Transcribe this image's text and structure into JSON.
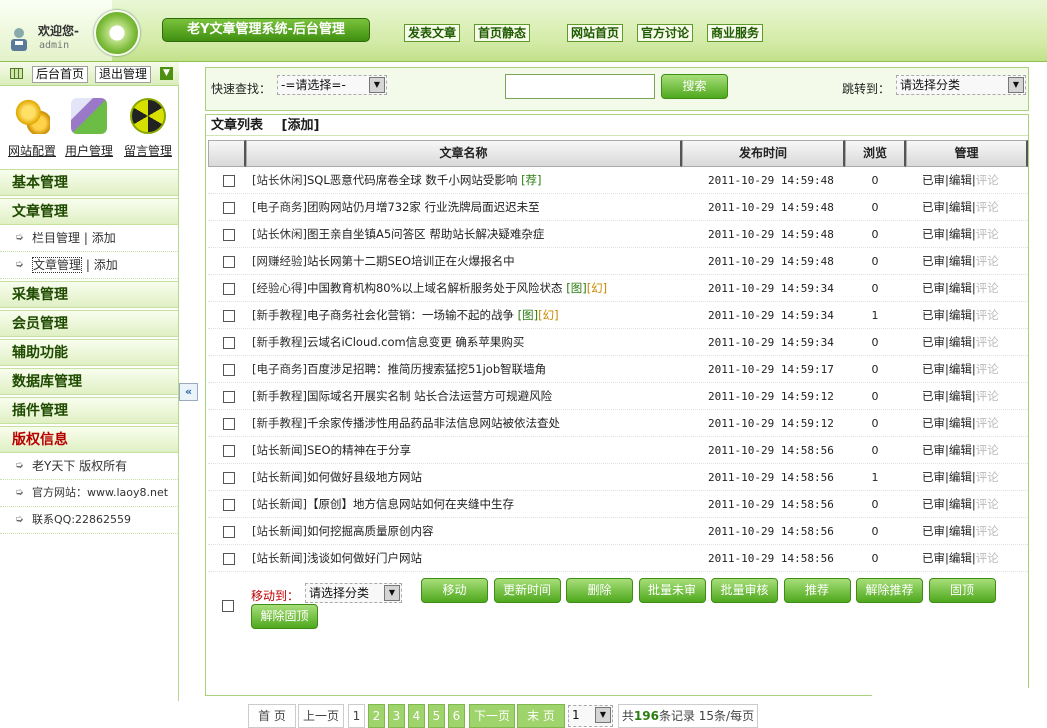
{
  "header": {
    "welcome": "欢迎您-",
    "username": "admin",
    "system_title": "老Y文章管理系统-后台管理",
    "nav": [
      "发表文章",
      "首页静态",
      "网站首页",
      "官方讨论",
      "商业服务"
    ]
  },
  "sidebar": {
    "home_btn": "后台首页",
    "logout_btn": "退出管理",
    "quick": [
      {
        "label": "网站配置",
        "icon": "gears-icon"
      },
      {
        "label": "用户管理",
        "icon": "user-edit-icon"
      },
      {
        "label": "留言管理",
        "icon": "radiation-icon"
      }
    ],
    "sections": [
      {
        "label": "基本管理"
      },
      {
        "label": "文章管理"
      },
      {
        "label": "采集管理"
      },
      {
        "label": "会员管理"
      },
      {
        "label": "辅助功能"
      },
      {
        "label": "数据库管理"
      },
      {
        "label": "插件管理"
      },
      {
        "label": "版权信息"
      }
    ],
    "article_items": [
      {
        "label": "栏目管理",
        "sep": " | ",
        "add": "添加"
      },
      {
        "label": "文章管理",
        "sep": " | ",
        "add": "添加"
      }
    ],
    "copyright_items": [
      "老Y天下 版权所有",
      "官方网站：www.laoy8.net",
      "联系QQ:22862559"
    ]
  },
  "search": {
    "label": "快速查找：",
    "select": "-=请选择=-",
    "button": "搜索",
    "jump_label": "跳转到：",
    "jump_select": "请选择分类"
  },
  "list": {
    "title": "文章列表",
    "add": "[添加]",
    "columns": [
      "文章名称",
      "发布时间",
      "浏览",
      "管理"
    ],
    "rows": [
      {
        "cat": "[站长休闲]",
        "title": "SQL恶意代码席卷全球 数千小网站受影响",
        "tag": "[荐]",
        "tag2": "",
        "time": "2011-10-29 14:59:48",
        "views": "0"
      },
      {
        "cat": "[电子商务]",
        "title": "团购网站仍月增732家 行业洗牌局面迟迟未至",
        "tag": "",
        "tag2": "",
        "time": "2011-10-29 14:59:48",
        "views": "0"
      },
      {
        "cat": "[站长休闲]",
        "title": "图王亲自坐镇A5问答区 帮助站长解决疑难杂症",
        "tag": "",
        "tag2": "",
        "time": "2011-10-29 14:59:48",
        "views": "0"
      },
      {
        "cat": "[网赚经验]",
        "title": "站长网第十二期SEO培训正在火爆报名中",
        "tag": "",
        "tag2": "",
        "time": "2011-10-29 14:59:48",
        "views": "0"
      },
      {
        "cat": "[经验心得]",
        "title": "中国教育机构80%以上域名解析服务处于风险状态",
        "tag": "[图]",
        "tag2": "[幻]",
        "time": "2011-10-29 14:59:34",
        "views": "0"
      },
      {
        "cat": "[新手教程]",
        "title": "电子商务社会化营销：一场输不起的战争",
        "tag": "[图]",
        "tag2": "[幻]",
        "time": "2011-10-29 14:59:34",
        "views": "1"
      },
      {
        "cat": "[新手教程]",
        "title": "云域名iCloud.com信息变更 确系苹果购买",
        "tag": "",
        "tag2": "",
        "time": "2011-10-29 14:59:34",
        "views": "0"
      },
      {
        "cat": "[电子商务]",
        "title": "百度涉足招聘：推简历搜索猛挖51job智联墙角",
        "tag": "",
        "tag2": "",
        "time": "2011-10-29 14:59:17",
        "views": "0"
      },
      {
        "cat": "[新手教程]",
        "title": "国际域名开展实名制 站长合法运营方可规避风险",
        "tag": "",
        "tag2": "",
        "time": "2011-10-29 14:59:12",
        "views": "0"
      },
      {
        "cat": "[新手教程]",
        "title": "千余家传播涉性用品药品非法信息网站被依法查处",
        "tag": "",
        "tag2": "",
        "time": "2011-10-29 14:59:12",
        "views": "0"
      },
      {
        "cat": "[站长新闻]",
        "title": "SEO的精神在于分享",
        "tag": "",
        "tag2": "",
        "time": "2011-10-29 14:58:56",
        "views": "0"
      },
      {
        "cat": "[站长新闻]",
        "title": "如何做好县级地方网站",
        "tag": "",
        "tag2": "",
        "time": "2011-10-29 14:58:56",
        "views": "1"
      },
      {
        "cat": "[站长新闻]",
        "title": "【原创】地方信息网站如何在夹缝中生存",
        "tag": "",
        "tag2": "",
        "time": "2011-10-29 14:58:56",
        "views": "0"
      },
      {
        "cat": "[站长新闻]",
        "title": "如何挖掘高质量原创内容",
        "tag": "",
        "tag2": "",
        "time": "2011-10-29 14:58:56",
        "views": "0"
      },
      {
        "cat": "[站长新闻]",
        "title": "浅谈如何做好门户网站",
        "tag": "",
        "tag2": "",
        "time": "2011-10-29 14:58:56",
        "views": "0"
      }
    ],
    "manage": {
      "approved": "已审",
      "edit": "编辑",
      "comment": "评论",
      "sep": "|"
    }
  },
  "batch": {
    "move_label": "移动到：",
    "select": "请选择分类",
    "buttons": [
      "移动",
      "更新时间",
      "删除",
      "批量未审",
      "批量审核",
      "推荐",
      "解除推荐",
      "固顶",
      "解除固顶"
    ]
  },
  "pager": {
    "first": "首 页",
    "prev": "上一页",
    "pages": [
      "1",
      "2",
      "3",
      "4",
      "5",
      "6"
    ],
    "next": "下一页",
    "last": "末 页",
    "select": "1",
    "total_prefix": "共",
    "total": "196",
    "total_suffix": "条记录 15条/每页"
  },
  "colors": {
    "accent": "#4ea81d",
    "panel": "#f3faea"
  }
}
